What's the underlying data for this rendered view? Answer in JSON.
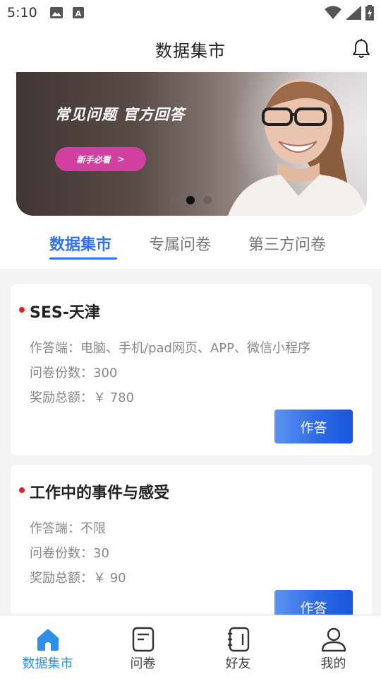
{
  "status_bar": {
    "time": "5:10"
  },
  "header": {
    "title": "数据集市"
  },
  "banner": {
    "title": "常见问题  官方回答",
    "pill_label": "新手必看",
    "pill_arrow": ">",
    "active_slide": 2,
    "slide_count": 3
  },
  "tabs": [
    {
      "label": "数据集市",
      "active": true
    },
    {
      "label": "专属问卷",
      "active": false
    },
    {
      "label": "第三方问卷",
      "active": false
    }
  ],
  "surveys": [
    {
      "title": "SES-天津",
      "device": "作答端：电脑、手机/pad网页、APP、微信小程序",
      "copies": "问卷份数：300",
      "reward": "奖励总额：￥ 780",
      "button": "作答"
    },
    {
      "title": "工作中的事件与感受",
      "device": "作答端：不限",
      "copies": "问卷份数：30",
      "reward": "奖励总额：￥ 90",
      "button": "作答"
    }
  ],
  "bottom_nav": [
    {
      "label": "数据集市",
      "icon": "home-icon",
      "active": true
    },
    {
      "label": "问卷",
      "icon": "survey-icon",
      "active": false
    },
    {
      "label": "好友",
      "icon": "contacts-icon",
      "active": false
    },
    {
      "label": "我的",
      "icon": "profile-icon",
      "active": false
    }
  ],
  "colors": {
    "accent": "#3273e6",
    "nav_active": "#2b8fe8",
    "bullet": "#e52222",
    "pill": "#d13fa0"
  }
}
